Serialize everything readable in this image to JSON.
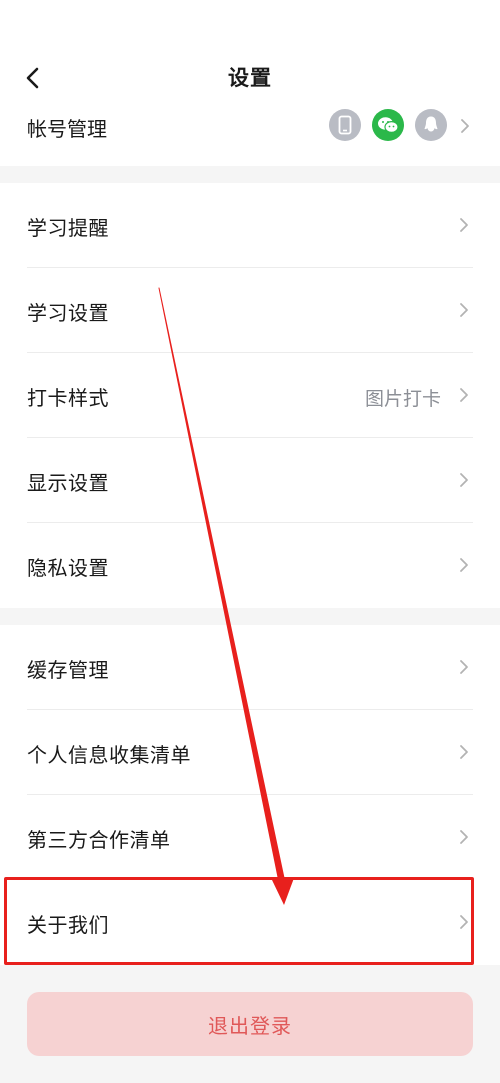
{
  "header": {
    "title": "设置",
    "back_icon": "chevron-left-icon"
  },
  "account": {
    "label": "帐号管理",
    "bindings": [
      "phone-icon",
      "wechat-icon",
      "qq-icon"
    ],
    "colors": {
      "inactive": "#b9bcc4",
      "wechat": "#2bb84a"
    }
  },
  "section1": {
    "items": [
      {
        "label": "学习提醒",
        "value": ""
      },
      {
        "label": "学习设置",
        "value": ""
      },
      {
        "label": "打卡样式",
        "value": "图片打卡"
      },
      {
        "label": "显示设置",
        "value": ""
      },
      {
        "label": "隐私设置",
        "value": ""
      }
    ]
  },
  "section2": {
    "items": [
      {
        "label": "缓存管理"
      },
      {
        "label": "个人信息收集清单"
      },
      {
        "label": "第三方合作清单"
      },
      {
        "label": "关于我们"
      }
    ]
  },
  "logout": {
    "label": "退出登录",
    "bg_color": "#f6d2d2",
    "text_color": "#e05858"
  },
  "annotation": {
    "color": "#e8201d",
    "target": "关于我们"
  }
}
